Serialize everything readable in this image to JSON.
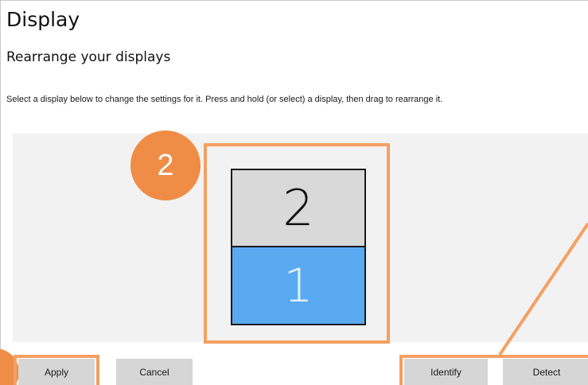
{
  "page": {
    "title": "Display",
    "section_title": "Rearrange your displays",
    "description": "Select a display below to change the settings for it. Press and hold (or select) a display, then drag to rearrange it."
  },
  "monitors": [
    {
      "number": "2",
      "selected": false
    },
    {
      "number": "1",
      "selected": true
    }
  ],
  "step_badge": {
    "label": "2"
  },
  "buttons": {
    "apply": "Apply",
    "cancel": "Cancel",
    "identify": "Identify",
    "detect": "Detect"
  },
  "colors": {
    "highlight": "#f4a062",
    "badge": "#ef8c45",
    "selected_display": "#5aaaf2",
    "unselected_display": "#d9d9d9",
    "button": "#d6d6d6"
  }
}
